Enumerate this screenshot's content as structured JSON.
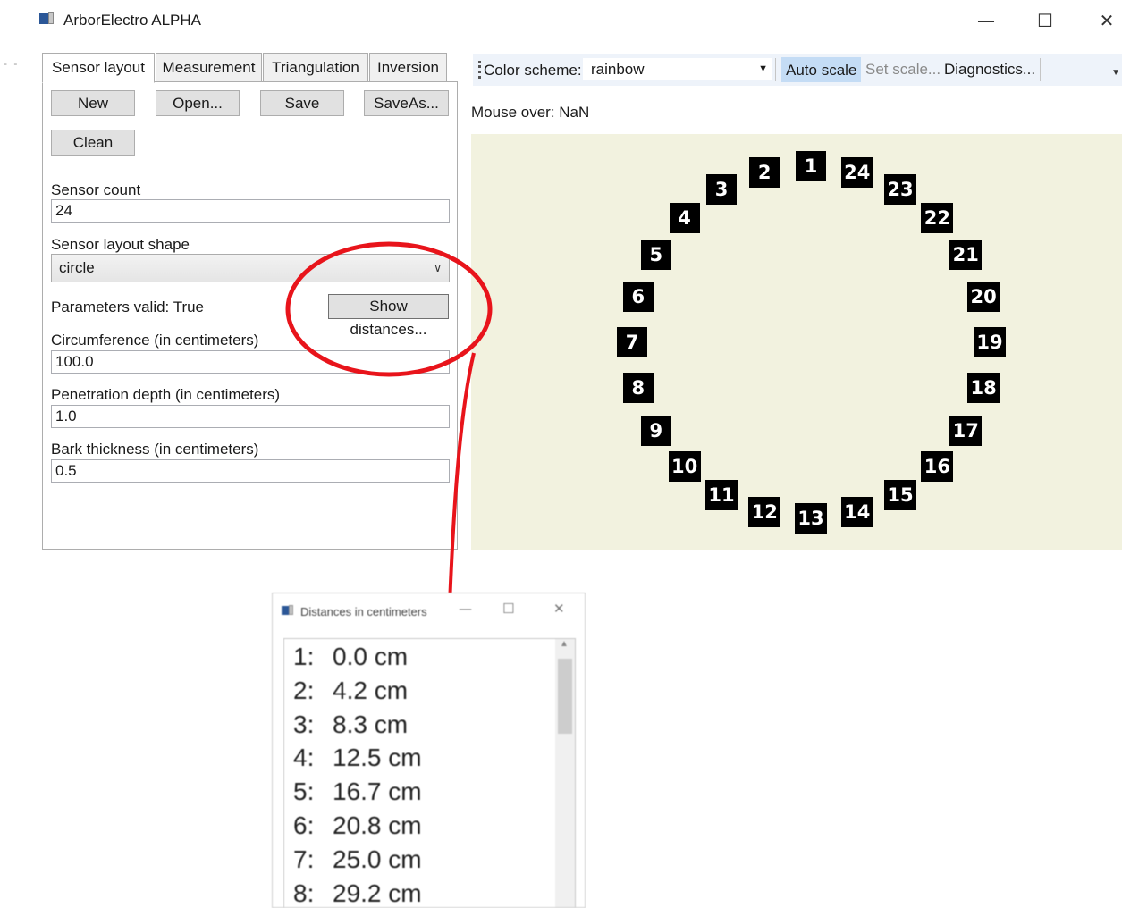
{
  "window": {
    "title": "ArborElectro ALPHA",
    "minimize_glyph": "—",
    "maximize_glyph": "☐",
    "close_glyph": "✕"
  },
  "left_panel": {
    "tabs": [
      "Sensor layout",
      "Measurement",
      "Triangulation",
      "Inversion"
    ],
    "active_tab": "Sensor layout",
    "buttons": {
      "new": "New",
      "open": "Open...",
      "save": "Save",
      "save_as": "SaveAs...",
      "clean": "Clean",
      "show_distances": "Show distances..."
    },
    "sensor_count_label": "Sensor count",
    "sensor_count_value": "24",
    "shape_label": "Sensor layout shape",
    "shape_value": "circle",
    "params_valid": "Parameters valid: True",
    "circumference_label": "Circumference (in centimeters)",
    "circumference_value": "100.0",
    "penetration_label": "Penetration depth (in centimeters)",
    "penetration_value": "1.0",
    "bark_label": "Bark thickness (in centimeters)",
    "bark_value": "0.5"
  },
  "toolbar": {
    "color_scheme_label": "Color scheme:",
    "color_scheme_value": "rainbow",
    "auto_scale": "Auto scale",
    "set_scale": "Set scale...",
    "diagnostics": "Diagnostics..."
  },
  "mouse_over": "Mouse over: NaN",
  "canvas": {
    "background": "#f2f2df",
    "sensors": [
      "1",
      "2",
      "3",
      "4",
      "5",
      "6",
      "7",
      "8",
      "9",
      "10",
      "11",
      "12",
      "13",
      "14",
      "15",
      "16",
      "17",
      "18",
      "19",
      "20",
      "21",
      "22",
      "23",
      "24"
    ]
  },
  "annotation": {
    "color": "#e8141b"
  },
  "popup": {
    "title": "Distances in centimeters",
    "items": [
      {
        "num": "1:",
        "value": "0.0 cm"
      },
      {
        "num": "2:",
        "value": "4.2 cm"
      },
      {
        "num": "3:",
        "value": "8.3 cm"
      },
      {
        "num": "4:",
        "value": "12.5 cm"
      },
      {
        "num": "5:",
        "value": "16.7 cm"
      },
      {
        "num": "6:",
        "value": "20.8 cm"
      },
      {
        "num": "7:",
        "value": "25.0 cm"
      },
      {
        "num": "8:",
        "value": "29.2 cm"
      }
    ]
  }
}
